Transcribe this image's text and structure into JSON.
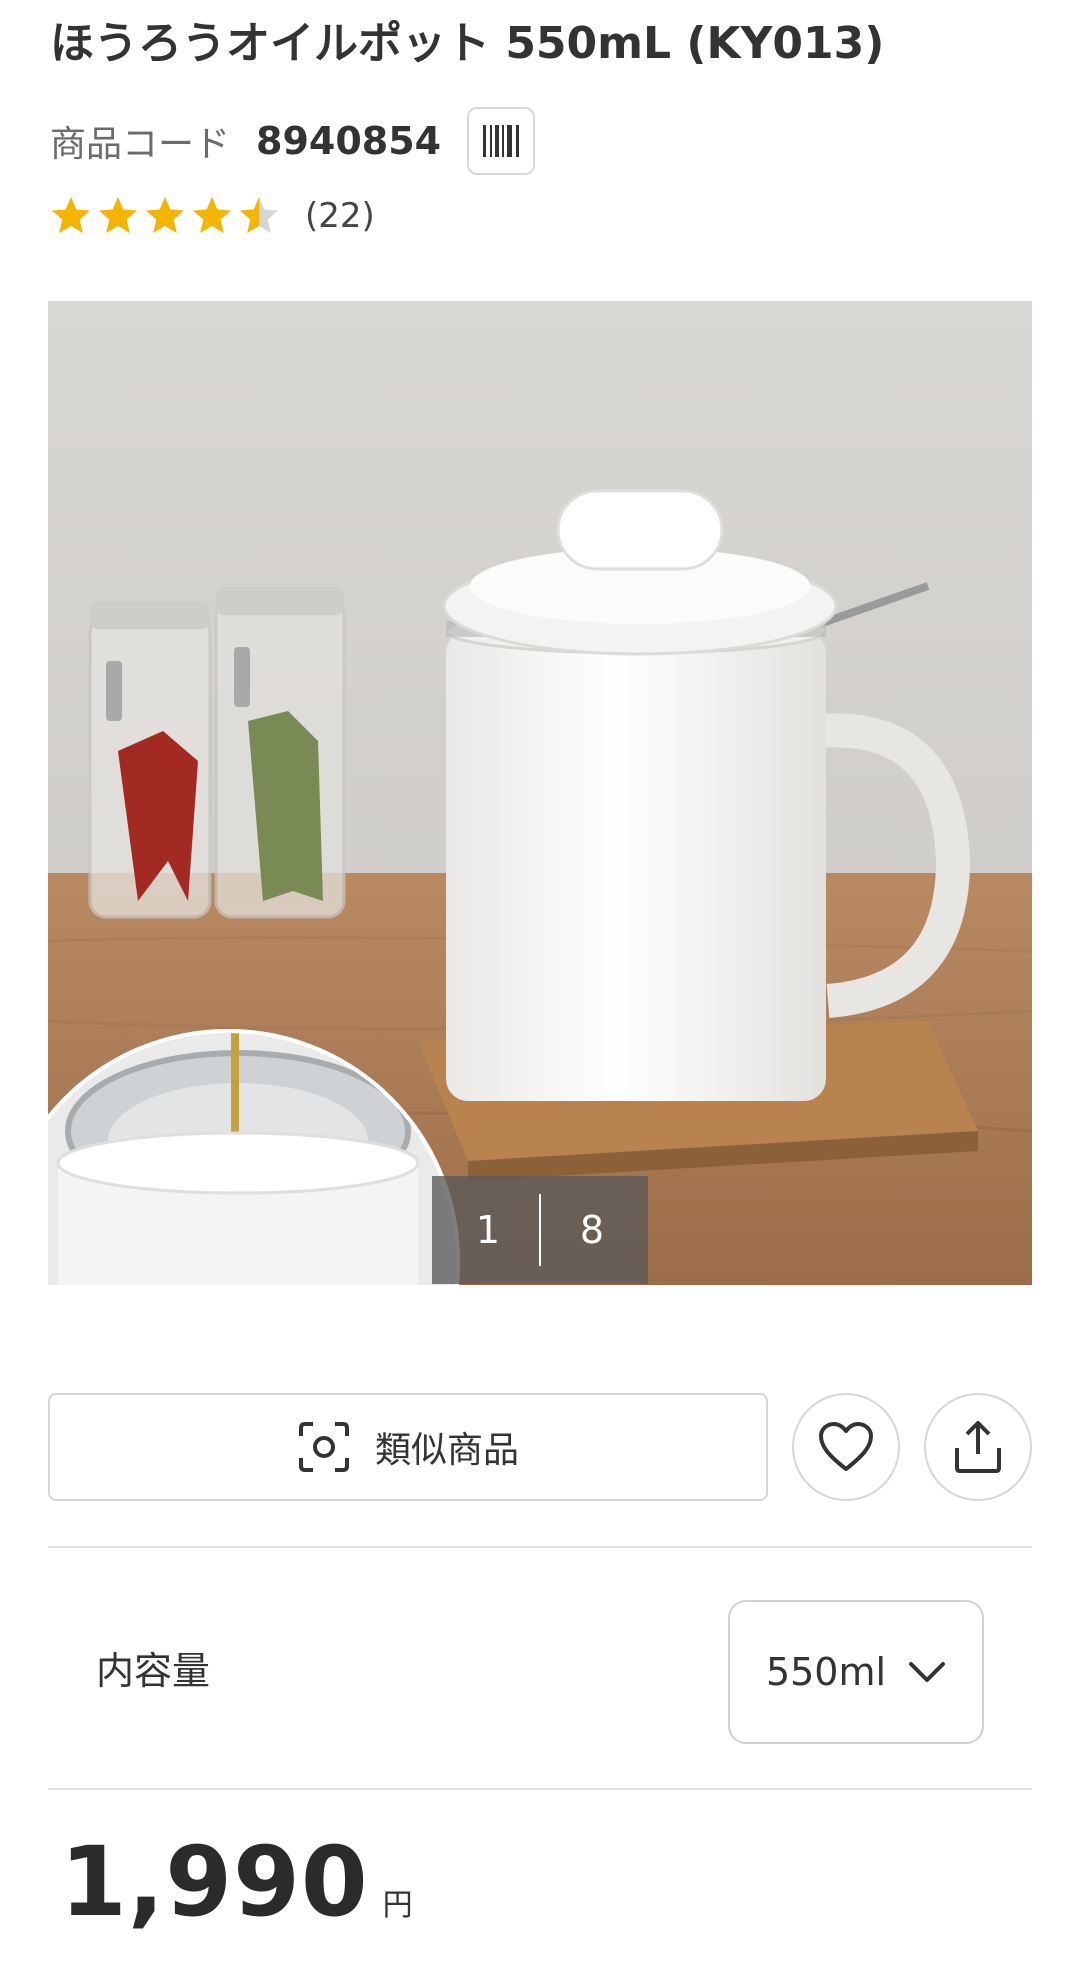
{
  "product": {
    "title": "ほうろうオイルポット 550mL (KY013)",
    "code_label": "商品コード",
    "code_value": "8940854",
    "barcode_icon": "barcode-icon",
    "rating": {
      "value": 4.5,
      "max": 5,
      "count_text": "(22)",
      "star_color": "#f5b400",
      "empty_star_color": "#d5d5d5"
    }
  },
  "gallery": {
    "current": "1",
    "total": "8"
  },
  "actions": {
    "similar_label": "類似商品",
    "similar_icon": "scan-icon",
    "favorite_icon": "heart-icon",
    "share_icon": "share-icon"
  },
  "option": {
    "label": "内容量",
    "selected": "550ml",
    "chevron_icon": "chevron-down-icon"
  },
  "price": {
    "amount": "1,990",
    "unit": "円"
  }
}
